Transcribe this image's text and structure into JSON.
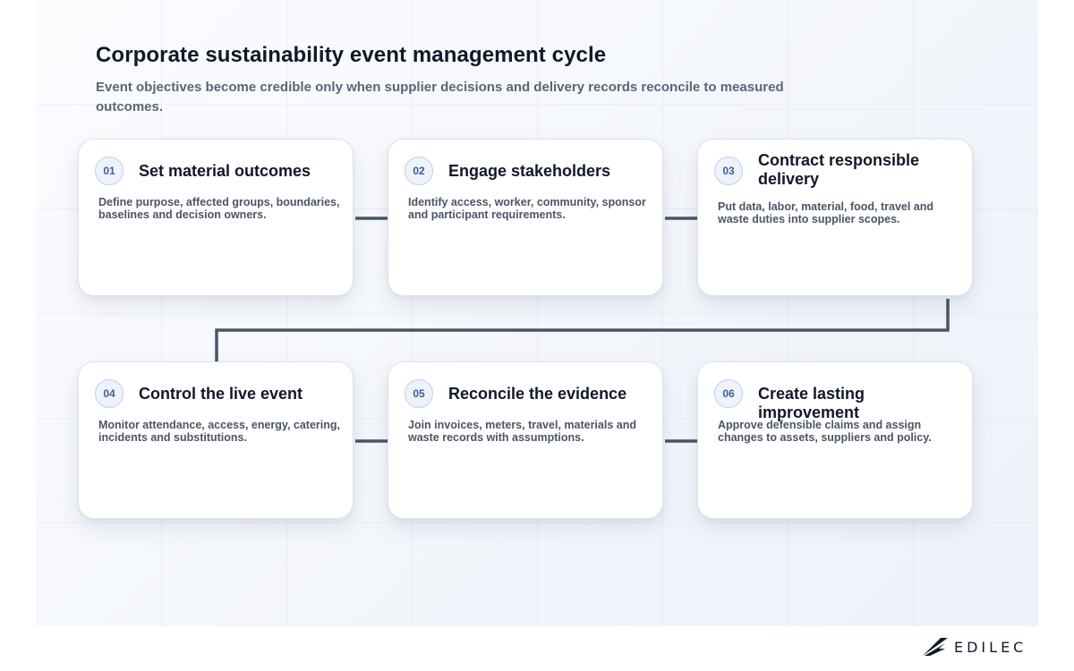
{
  "header": {
    "title": "Corporate sustainability event management cycle",
    "subtitle": "Event objectives become credible only when supplier decisions and delivery records reconcile to measured outcomes."
  },
  "steps": [
    {
      "number": "01",
      "title": "Set material outcomes",
      "description": "Define purpose, affected groups, boundaries, baselines and decision owners."
    },
    {
      "number": "02",
      "title": "Engage stakeholders",
      "description": "Identify access, worker, community, sponsor and participant requirements."
    },
    {
      "number": "03",
      "title": "Contract responsible delivery",
      "description": "Put data, labor, material, food, travel and waste duties into supplier scopes."
    },
    {
      "number": "04",
      "title": "Control the live event",
      "description": "Monitor attendance, access, energy, catering, incidents and substitutions."
    },
    {
      "number": "05",
      "title": "Reconcile the evidence",
      "description": "Join invoices, meters, travel, materials and waste records with assumptions."
    },
    {
      "number": "06",
      "title": "Create lasting improvement",
      "description": "Approve defensible claims and assign changes to assets, suppliers and policy."
    }
  ],
  "brand": {
    "logo_text": "EDILEC",
    "logo_icon": "wing-icon"
  },
  "colors": {
    "connector": "#4a5568",
    "badge_border": "#bcd0ee",
    "badge_text": "#3a5f98",
    "title_text": "#111827"
  }
}
